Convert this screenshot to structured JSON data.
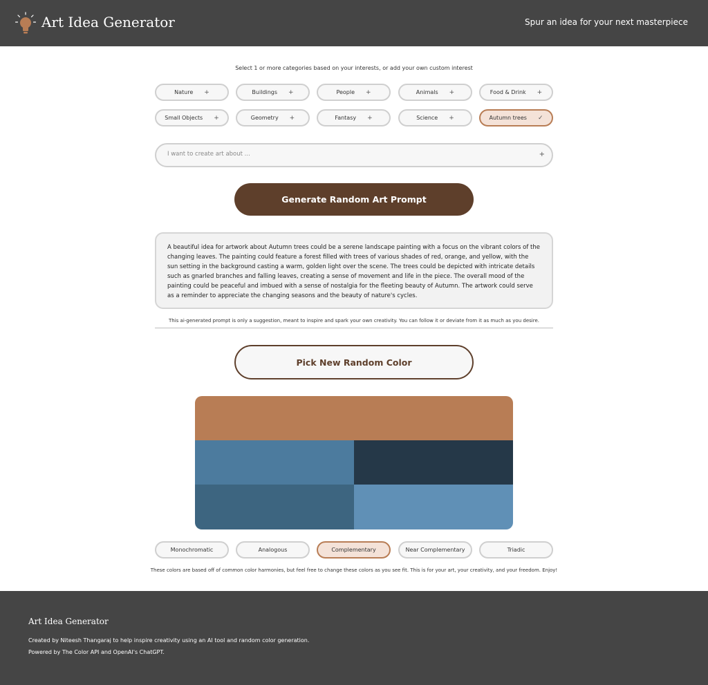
{
  "header": {
    "title": "Art Idea Generator",
    "tagline": "Spur an idea for your next masterpiece",
    "logo_icon": "lightbulb-icon",
    "accent": "#b87d55"
  },
  "categories": {
    "instruction": "Select 1 or more categories based on your interests, or add your own custom interest",
    "items": [
      {
        "label": "Nature",
        "icon": "+"
      },
      {
        "label": "Buildings",
        "icon": "+"
      },
      {
        "label": "People",
        "icon": "+"
      },
      {
        "label": "Animals",
        "icon": "+"
      },
      {
        "label": "Food & Drink",
        "icon": "+"
      },
      {
        "label": "Small Objects",
        "icon": "+"
      },
      {
        "label": "Geometry",
        "icon": "+"
      },
      {
        "label": "Fantasy",
        "icon": "+"
      },
      {
        "label": "Science",
        "icon": "+"
      },
      {
        "label": "Autumn trees",
        "icon": "✓",
        "selected": true
      }
    ]
  },
  "custom": {
    "placeholder": "I want to create art about ...",
    "add_icon": "+"
  },
  "generate": {
    "label": "Generate Random Art Prompt",
    "color": "#5e3f2b"
  },
  "prompt": {
    "text": "A beautiful idea for artwork about Autumn trees could be a serene landscape painting with a focus on the vibrant colors of the changing leaves. The painting could feature a forest filled with trees of various shades of red, orange, and yellow, with the sun setting in the background casting a warm, golden light over the scene. The trees could be depicted with intricate details such as gnarled branches and falling leaves, creating a sense of movement and life in the piece. The overall mood of the painting could be peaceful and imbued with a sense of nostalgia for the fleeting beauty of Autumn. The artwork could serve as a reminder to appreciate the changing seasons and the beauty of nature's cycles.",
    "disclaimer": "This ai-generated prompt is only a suggestion, meant to inspire and spark your own creativity. You can follow it or deviate from it as much as you desire."
  },
  "color_picker": {
    "label": "Pick New Random Color",
    "palette": [
      "#b87d55",
      "#4c7b9e",
      "#253848",
      "#3d6580",
      "#6090b6"
    ],
    "harmonies": [
      {
        "label": "Monochromatic"
      },
      {
        "label": "Analogous"
      },
      {
        "label": "Complementary",
        "selected": true
      },
      {
        "label": "Near Complementary"
      },
      {
        "label": "Triadic"
      }
    ],
    "note": "These colors are based off of common color harmonies, but feel free to change these colors as you see fit. This is for your art, your creativity, and your freedom. Enjoy!"
  },
  "footer": {
    "title": "Art Idea Generator",
    "line1": "Created by Niteesh Thangaraj to help inspire creativity using an AI tool and random color generation.",
    "line2": "Powered by The Color API and OpenAI's ChatGPT."
  }
}
